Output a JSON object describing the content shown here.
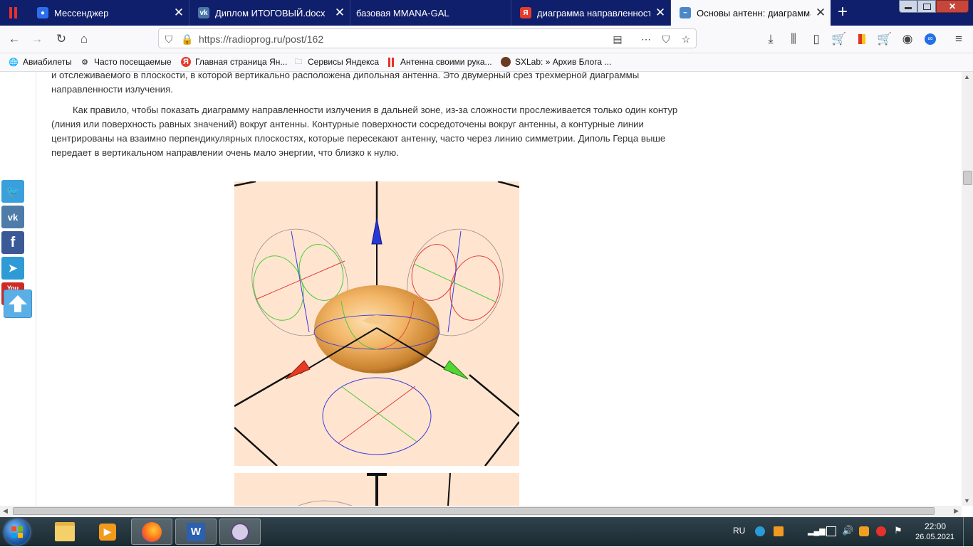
{
  "browser": {
    "tabs": [
      {
        "title": "Мессенджер",
        "icon": "messenger-icon",
        "color": "#2d6ef0"
      },
      {
        "title": "Диплом ИТОГОВЫЙ.docx",
        "icon": "vk-icon",
        "color": "#4a76a8"
      },
      {
        "title": "базовая MMANA-GAL",
        "icon": "page-icon",
        "color": "#3b4a99"
      },
      {
        "title": "диаграмма направленности а",
        "icon": "yandex-icon",
        "color": "#e63b2e"
      },
      {
        "title": "Основы антенн: диаграмма н",
        "icon": "radioprog-icon",
        "color": "#4a88c8"
      }
    ],
    "url": "https://radioprog.ru/post/162",
    "bookmarks": [
      {
        "label": "Авиабилеты",
        "icon": "globe-icon"
      },
      {
        "label": "Часто посещаемые",
        "icon": "gear-icon"
      },
      {
        "label": "Главная страница Ян...",
        "icon": "yandex-icon"
      },
      {
        "label": "Сервисы Яндекса",
        "icon": "folder-icon"
      },
      {
        "label": "Антенна своими рука...",
        "icon": "bars-icon"
      },
      {
        "label": "SXLab: » Архив Блога ...",
        "icon": "sxlab-icon"
      }
    ]
  },
  "article": {
    "para1": "и отслеживаемого в плоскости, в которой вертикально расположена дипольная антенна. Это двумерный срез трехмерной диаграммы направленности излучения.",
    "para2": "Как правило, чтобы показать диаграмму направленности излучения в дальней зоне, из-за сложности прослеживается только один контур (линия или поверхность равных значений) вокруг антенны. Контурные поверхности сосредоточены вокруг антенны, а контурные линии центрированы на взаимно перпендикулярных плоскостях, которые пересекают антенну, часто через линию симметрии. Диполь Герца выше передает в вертикальном направлении очень мало энергии, что близко к нулю."
  },
  "social": [
    {
      "name": "twitter",
      "label": "t",
      "color": "#3aa0dc"
    },
    {
      "name": "vk",
      "label": "vk",
      "color": "#4f7ba8"
    },
    {
      "name": "facebook",
      "label": "f",
      "color": "#3b5997"
    },
    {
      "name": "telegram",
      "label": "➤",
      "color": "#2f9bd6"
    },
    {
      "name": "youtube",
      "label": "You",
      "color": "#cc2b24"
    }
  ],
  "taskbar": {
    "lang": "RU",
    "time": "22:00",
    "date": "26.05.2021",
    "apps": [
      {
        "name": "windows-explorer",
        "icon": "folder-icon"
      },
      {
        "name": "media-player",
        "icon": "media-icon"
      },
      {
        "name": "firefox",
        "icon": "firefox-icon"
      },
      {
        "name": "word",
        "icon": "word-icon"
      },
      {
        "name": "mmana",
        "icon": "antenna-app-icon"
      }
    ]
  },
  "image_1": {
    "labels": []
  }
}
